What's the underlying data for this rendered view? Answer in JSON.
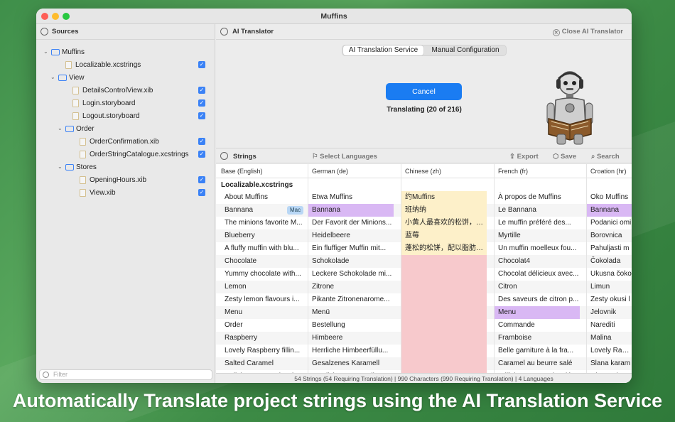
{
  "window": {
    "title": "Muffins"
  },
  "sidebar": {
    "header": "Sources",
    "filter_placeholder": "Filter",
    "tree": [
      {
        "label": "Muffins",
        "kind": "folder",
        "depth": 0,
        "checked": false
      },
      {
        "label": "Localizable.xcstrings",
        "kind": "file",
        "depth": 1,
        "checked": true
      },
      {
        "label": "View",
        "kind": "folder",
        "depth": 1,
        "checked": false
      },
      {
        "label": "DetailsControlView.xib",
        "kind": "file",
        "depth": 2,
        "checked": true
      },
      {
        "label": "Login.storyboard",
        "kind": "file",
        "depth": 2,
        "checked": true
      },
      {
        "label": "Logout.storyboard",
        "kind": "file",
        "depth": 2,
        "checked": true
      },
      {
        "label": "Order",
        "kind": "folder",
        "depth": 2,
        "checked": false
      },
      {
        "label": "OrderConfirmation.xib",
        "kind": "file",
        "depth": 3,
        "checked": true
      },
      {
        "label": "OrderStringCatalogue.xcstrings",
        "kind": "file",
        "depth": 3,
        "checked": true
      },
      {
        "label": "Stores",
        "kind": "folder",
        "depth": 2,
        "checked": false
      },
      {
        "label": "OpeningHours.xib",
        "kind": "file",
        "depth": 3,
        "checked": true
      },
      {
        "label": "View.xib",
        "kind": "file",
        "depth": 3,
        "checked": true
      }
    ]
  },
  "ai_panel": {
    "title": "AI Translator",
    "close_label": "Close AI Translator",
    "tabs": [
      "AI Translation Service",
      "Manual Configuration"
    ],
    "cancel_label": "Cancel",
    "progress_text": "Translating (20 of 216)"
  },
  "strings_panel": {
    "title": "Strings",
    "select_languages": "Select Languages",
    "export_label": "Export",
    "save_label": "Save",
    "search_label": "Search",
    "columns": [
      "Base (English)",
      "German (de)",
      "Chinese (zh)",
      "French (fr)",
      "Croation (hr)"
    ],
    "group": "Localizable.xcstrings",
    "rows": [
      {
        "base": "About Muffins",
        "de": "Etwa Muffins",
        "zh": "约Muffins",
        "fr": "À propos de Muffins",
        "hr": "Oko Muffins"
      },
      {
        "base": "Bannana",
        "badge": "Mac",
        "de": "Bannana",
        "zh": "班纳纳",
        "fr": "Le Bannana",
        "hr": "Bannana"
      },
      {
        "base": "The minions favorite M...",
        "de": "Der Favorit der Minions...",
        "zh": "小黄人最喜欢的松饼，香…",
        "fr": "Le muffin préféré des...",
        "hr": "Podanici omi"
      },
      {
        "base": "Blueberry",
        "de": "Heidelbeere",
        "zh": "蓝莓",
        "fr": "Myrtille",
        "hr": "Borovnica"
      },
      {
        "base": "A fluffy muffin with blu...",
        "de": "Ein fluffiger Muffin mit...",
        "zh": "蓬松的松饼，配以脂肪和…",
        "fr": "Un muffin moelleux fou...",
        "hr": "Pahuljasti m"
      },
      {
        "base": "Chocolate",
        "de": "Schokolade",
        "zh": "",
        "fr": "Chocolat4",
        "hr": "Čokolada"
      },
      {
        "base": "Yummy chocolate with...",
        "de": "Leckere Schokolade mi...",
        "zh": "",
        "fr": "Chocolat délicieux avec...",
        "hr": "Ukusna čoko"
      },
      {
        "base": "Lemon",
        "de": "Zitrone",
        "zh": "",
        "fr": "Citron",
        "hr": "Limun"
      },
      {
        "base": "Zesty lemon flavours i...",
        "de": "Pikante Zitronenarome...",
        "zh": "",
        "fr": "Des saveurs de citron p...",
        "hr": "Zesty okusi l"
      },
      {
        "base": "Menu",
        "de": "Menü",
        "zh": "",
        "fr": "Menu",
        "hr": "Jelovnik"
      },
      {
        "base": "Order",
        "de": "Bestellung",
        "zh": "",
        "fr": "Commande",
        "hr": "Narediti"
      },
      {
        "base": "Raspberry",
        "de": "Himbeere",
        "zh": "",
        "fr": "Framboise",
        "hr": "Malina"
      },
      {
        "base": "Lovely Raspberry fillin...",
        "de": "Herrliche Himbeerfüllu...",
        "zh": "",
        "fr": "Belle garniture à la fra...",
        "hr": "Lovely Raspb"
      },
      {
        "base": "Salted Caramel",
        "de": "Gesalzenes Karamell",
        "zh": "",
        "fr": "Caramel au beurre salé",
        "hr": "Slana karam"
      },
      {
        "base": "Delicious caramel, salt...",
        "de": "Köstliches Karamell, pe...",
        "zh": "",
        "fr": "Délicieux caramel, salé...",
        "hr": "Ukusna kara"
      }
    ],
    "status": "54 Strings (54 Requiring Translation) | 990 Characters (990 Requiring Translation) | 4 Languages"
  },
  "caption": "Automatically Translate project strings using the AI Translation Service",
  "colors": {
    "accent": "#1a7cf2",
    "zh_in_progress": "#fdf0c9",
    "zh_missing": "#f7c9cc",
    "highlight": "#d9b8f4",
    "background": "#3f8f4a"
  }
}
